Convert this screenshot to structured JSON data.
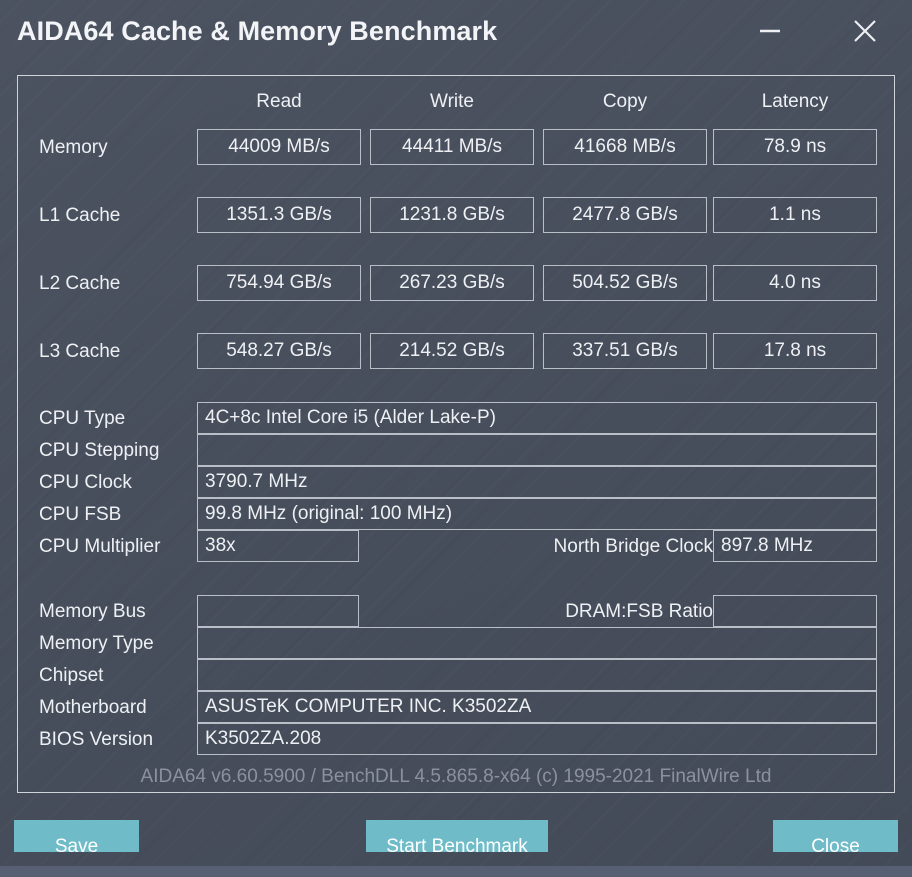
{
  "window": {
    "title": "AIDA64 Cache & Memory Benchmark",
    "minimize_label": "Minimize",
    "close_label": "Close"
  },
  "benchmark_table": {
    "columns": [
      "Read",
      "Write",
      "Copy",
      "Latency"
    ],
    "rows": [
      {
        "label": "Memory",
        "read": "44009 MB/s",
        "write": "44411 MB/s",
        "copy": "41668 MB/s",
        "latency": "78.9 ns"
      },
      {
        "label": "L1 Cache",
        "read": "1351.3 GB/s",
        "write": "1231.8 GB/s",
        "copy": "2477.8 GB/s",
        "latency": "1.1 ns"
      },
      {
        "label": "L2 Cache",
        "read": "754.94 GB/s",
        "write": "267.23 GB/s",
        "copy": "504.52 GB/s",
        "latency": "4.0 ns"
      },
      {
        "label": "L3 Cache",
        "read": "548.27 GB/s",
        "write": "214.52 GB/s",
        "copy": "337.51 GB/s",
        "latency": "17.8 ns"
      }
    ]
  },
  "cpu_info": {
    "cpu_type_label": "CPU Type",
    "cpu_type_value": "4C+8c Intel Core i5  (Alder Lake-P)",
    "cpu_stepping_label": "CPU Stepping",
    "cpu_stepping_value": "",
    "cpu_clock_label": "CPU Clock",
    "cpu_clock_value": "3790.7 MHz",
    "cpu_fsb_label": "CPU FSB",
    "cpu_fsb_value": "99.8 MHz  (original: 100 MHz)",
    "cpu_multiplier_label": "CPU Multiplier",
    "cpu_multiplier_value": "38x",
    "north_bridge_clock_label": "North Bridge Clock",
    "north_bridge_clock_value": "897.8 MHz"
  },
  "memory_info": {
    "memory_bus_label": "Memory Bus",
    "memory_bus_value": "",
    "dram_fsb_ratio_label": "DRAM:FSB Ratio",
    "dram_fsb_ratio_value": "",
    "memory_type_label": "Memory Type",
    "memory_type_value": "",
    "chipset_label": "Chipset",
    "chipset_value": "",
    "motherboard_label": "Motherboard",
    "motherboard_value": "ASUSTeK COMPUTER INC. K3502ZA",
    "bios_version_label": "BIOS Version",
    "bios_version_value": "K3502ZA.208"
  },
  "footer": {
    "version_text": "AIDA64 v6.60.5900 / BenchDLL 4.5.865.8-x64  (c) 1995-2021 FinalWire Ltd",
    "save_label": "Save",
    "start_benchmark_label": "Start Benchmark",
    "close_label": "Close"
  },
  "colors": {
    "background": "#474e5c",
    "border": "#cfd4da",
    "text": "#eef0f3",
    "accent_button": "#6fbcc8",
    "footer_text": "#8b929e",
    "bottom_strip": "#566072"
  }
}
